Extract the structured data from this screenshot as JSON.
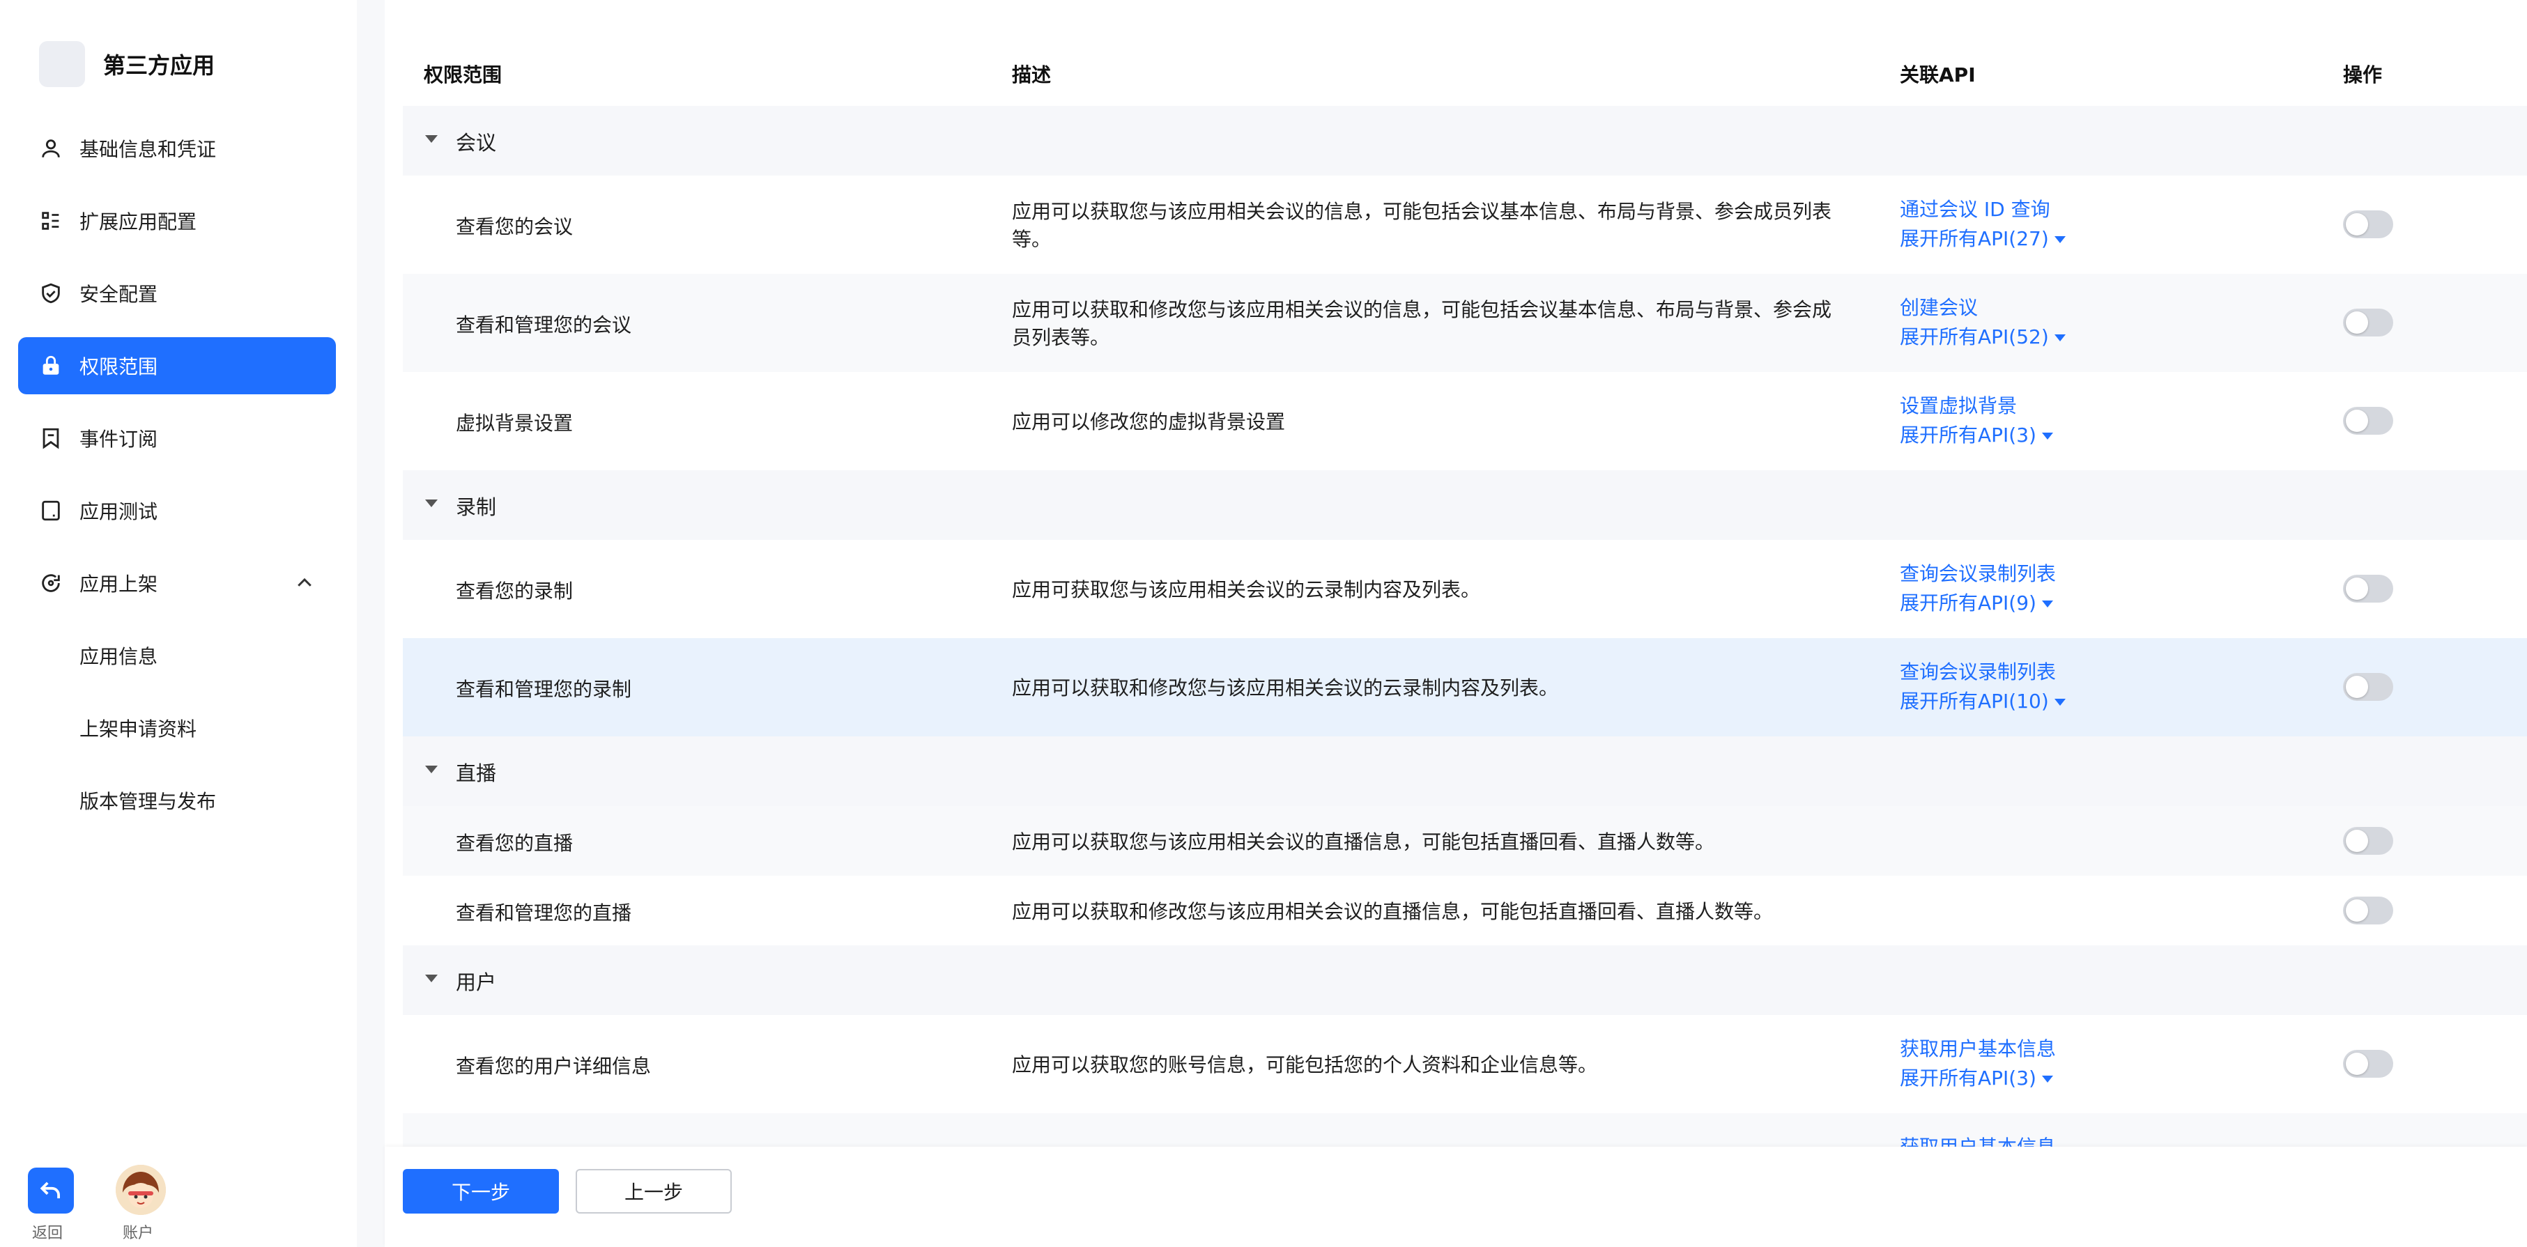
{
  "app": {
    "name": "第三方应用"
  },
  "sidebar": {
    "items": [
      {
        "label": "基础信息和凭证",
        "icon": "user-icon"
      },
      {
        "label": "扩展应用配置",
        "icon": "list-config-icon"
      },
      {
        "label": "安全配置",
        "icon": "shield-icon"
      },
      {
        "label": "权限范围",
        "icon": "lock-icon",
        "active": true
      },
      {
        "label": "事件订阅",
        "icon": "bookmark-icon"
      },
      {
        "label": "应用测试",
        "icon": "tablet-icon"
      },
      {
        "label": "应用上架",
        "icon": "publish-icon"
      }
    ],
    "sub_items": [
      {
        "label": "应用信息"
      },
      {
        "label": "上架申请资料"
      },
      {
        "label": "版本管理与发布"
      }
    ],
    "back_label": "返回",
    "account_label": "账户"
  },
  "table": {
    "headers": {
      "scope": "权限范围",
      "desc": "描述",
      "api": "关联API",
      "action": "操作"
    },
    "groups": [
      {
        "name": "会议"
      },
      {
        "name": "录制"
      },
      {
        "name": "直播"
      },
      {
        "name": "用户"
      }
    ],
    "rows": [
      {
        "scope": "查看您的会议",
        "desc": "应用可以获取您与该应用相关会议的信息，可能包括会议基本信息、布局与背景、参会成员列表等。",
        "api": "通过会议 ID 查询",
        "expand": "展开所有API(27)"
      },
      {
        "scope": "查看和管理您的会议",
        "desc": "应用可以获取和修改您与该应用相关会议的信息，可能包括会议基本信息、布局与背景、参会成员列表等。",
        "api": "创建会议",
        "expand": "展开所有API(52)"
      },
      {
        "scope": "虚拟背景设置",
        "desc": "应用可以修改您的虚拟背景设置",
        "api": "设置虚拟背景",
        "expand": "展开所有API(3)"
      },
      {
        "scope": "查看您的录制",
        "desc": "应用可获取您与该应用相关会议的云录制内容及列表。",
        "api": "查询会议录制列表",
        "expand": "展开所有API(9)"
      },
      {
        "scope": "查看和管理您的录制",
        "desc": "应用可以获取和修改您与该应用相关会议的云录制内容及列表。",
        "api": "查询会议录制列表",
        "expand": "展开所有API(10)"
      },
      {
        "scope": "查看您的直播",
        "desc": "应用可以获取您与该应用相关会议的直播信息，可能包括直播回看、直播人数等。"
      },
      {
        "scope": "查看和管理您的直播",
        "desc": "应用可以获取和修改您与该应用相关会议的直播信息，可能包括直播回看、直播人数等。"
      },
      {
        "scope": "查看您的用户详细信息",
        "desc": "应用可以获取您的账号信息，可能包括您的个人资料和企业信息等。",
        "api": "获取用户基本信息",
        "expand": "展开所有API(3)"
      },
      {
        "api": "获取用户基本信息"
      }
    ]
  },
  "footer": {
    "next_label": "下一步",
    "prev_label": "上一步"
  },
  "colors": {
    "accent": "#1f6fff",
    "highlight_row": "#e9f2fd",
    "group_bg": "#f6f7fa",
    "toggle_off": "#d5d8de"
  }
}
